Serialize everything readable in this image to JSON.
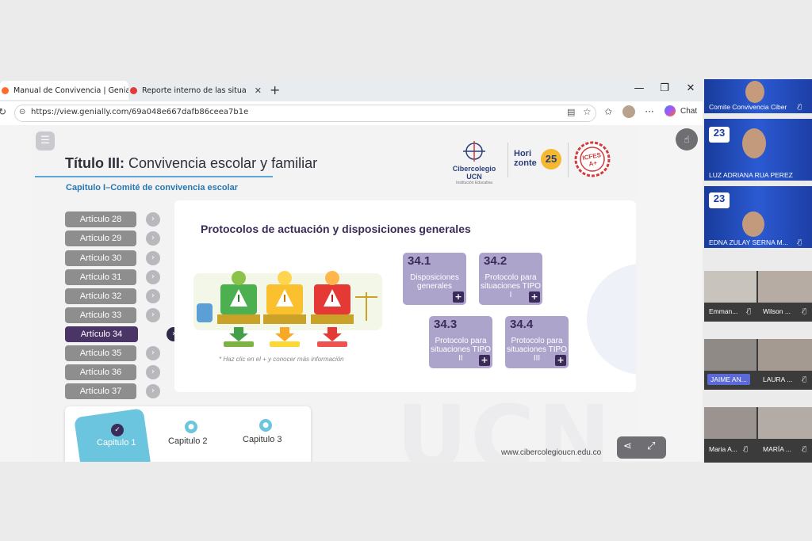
{
  "browser": {
    "tabs": [
      {
        "title": "Manual de Convivencia | Genially",
        "active": true
      },
      {
        "title": "Reporte interno de las situaciones",
        "active": false
      }
    ],
    "url": "https://view.genially.com/69a048e667dafb86ceea7b1e",
    "chat_label": "Chat"
  },
  "slide": {
    "title_bold": "Título III:",
    "title_rest": " Convivencia escolar y familiar",
    "chapter_subtitle": "Capitulo I–Comité de convivencia escolar",
    "logos": {
      "ucn_name": "Cibercolegio UCN",
      "ucn_sub": "Institución Educativa",
      "horizonte": "Hori zonte",
      "horizonte_num": "25",
      "icfes": "ICFES A+"
    },
    "articles": [
      {
        "label": "Artículo 28",
        "active": false
      },
      {
        "label": "Artículo 29",
        "active": false
      },
      {
        "label": "Artículo 30",
        "active": false
      },
      {
        "label": "Artículo 31",
        "active": false
      },
      {
        "label": "Artículo 32",
        "active": false
      },
      {
        "label": "Artículo 33",
        "active": false
      },
      {
        "label": "Artículo 34",
        "active": true
      },
      {
        "label": "Artículo 35",
        "active": false
      },
      {
        "label": "Artículo 36",
        "active": false
      },
      {
        "label": "Artículo 37",
        "active": false
      }
    ],
    "panel_title": "Protocolos de actuación y disposiciones generales",
    "hint": "* Haz clic en el + y conocer más información",
    "cards": [
      {
        "num": "34.1",
        "label": "Disposiciones generales"
      },
      {
        "num": "34.2",
        "label": "Protocolo para situaciones TIPO I"
      },
      {
        "num": "34.3",
        "label": "Protocolo para situaciones TIPO II"
      },
      {
        "num": "34.4",
        "label": "Protocolo para situaciones TIPO III"
      }
    ],
    "plus": "+",
    "chapters": [
      {
        "label": "Capitulo 1",
        "active": true
      },
      {
        "label": "Capitulo 2",
        "active": false
      },
      {
        "label": "Capitulo 3",
        "active": false
      }
    ],
    "site": "www.cibercolegioucn.edu.co",
    "watermark": "UCN"
  },
  "meeting": {
    "participants": [
      {
        "name": "Comite Convivencia Ciber"
      },
      {
        "name": "LUZ ADRIANA RUA PEREZ"
      },
      {
        "name": "EDNA ZULAY SERNA M..."
      },
      {
        "name": "Emman..."
      },
      {
        "name": "Wilson ..."
      },
      {
        "name": "JAIME AN..."
      },
      {
        "name": "LAURA ..."
      },
      {
        "name": "Maria A..."
      },
      {
        "name": "MARÍA ..."
      }
    ],
    "badge": "23"
  },
  "colors": {
    "accent_purple": "#3b2b5a",
    "card_purple": "#ada4cc",
    "article_gray": "#8e8e8e",
    "active_article": "#4b3566",
    "chapter_blue": "#6cc5df"
  }
}
